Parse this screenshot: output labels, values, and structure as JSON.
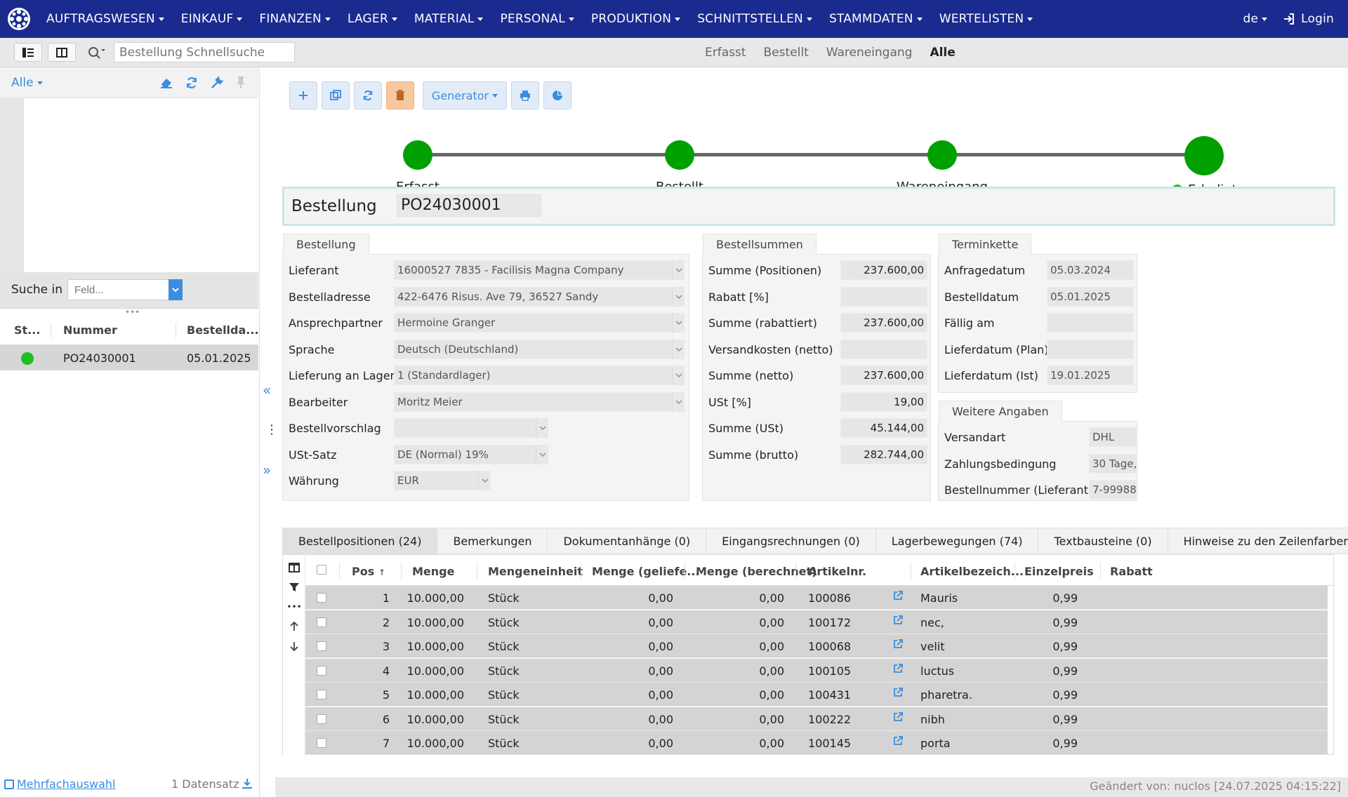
{
  "nav": {
    "menus": [
      "AUFTRAGSWESEN",
      "EINKAUF",
      "FINANZEN",
      "LAGER",
      "MATERIAL",
      "PERSONAL",
      "PRODUKTION",
      "SCHNITTSTELLEN",
      "STAMMDATEN",
      "WERTELISTEN"
    ],
    "language": "de",
    "login": "Login"
  },
  "subbar": {
    "search_placeholder": "Bestellung Schnellsuche",
    "filters": [
      "Erfasst",
      "Bestellt",
      "Wareneingang",
      "Alle"
    ],
    "active_filter": "Alle"
  },
  "left": {
    "filter": "Alle",
    "search_label": "Suche in",
    "search_placeholder": "Feld...",
    "columns": [
      "St...",
      "Nummer",
      "Bestellda..."
    ],
    "row": {
      "number": "PO24030001",
      "date": "05.01.2025",
      "status_color": "#1fbf1f"
    },
    "multi_select": "Mehrfachauswahl",
    "record_count": "1 Datensatz"
  },
  "toolbar": {
    "generator": "Generator"
  },
  "progress": {
    "steps": [
      "Erfasst",
      "Bestellt",
      "Wareneingang",
      "Erledigt"
    ],
    "current": "Erledigt",
    "color": "#00a000"
  },
  "order": {
    "label": "Bestellung",
    "number": "PO24030001"
  },
  "bestellung": {
    "title": "Bestellung",
    "fields": [
      {
        "label": "Lieferant",
        "value": "16000527 7835 - Facilisis Magna Company"
      },
      {
        "label": "Bestelladresse",
        "value": "422-6476 Risus. Ave 79, 36527 Sandy"
      },
      {
        "label": "Ansprechpartner",
        "value": "Hermoine Granger"
      },
      {
        "label": "Sprache",
        "value": "Deutsch (Deutschland)"
      },
      {
        "label": "Lieferung an Lager",
        "value": "1 (Standardlager)"
      },
      {
        "label": "Bearbeiter",
        "value": "Moritz Meier"
      },
      {
        "label": "Bestellvorschlag",
        "value": ""
      },
      {
        "label": "USt-Satz",
        "value": "DE (Normal) 19%"
      },
      {
        "label": "Währung",
        "value": "EUR"
      }
    ]
  },
  "summen": {
    "title": "Bestellsummen",
    "fields": [
      {
        "label": "Summe (Positionen)",
        "value": "237.600,00"
      },
      {
        "label": "Rabatt [%]",
        "value": ""
      },
      {
        "label": "Summe (rabattiert)",
        "value": "237.600,00"
      },
      {
        "label": "Versandkosten (netto)",
        "value": ""
      },
      {
        "label": "Summe (netto)",
        "value": "237.600,00"
      },
      {
        "label": "USt [%]",
        "value": "19,00"
      },
      {
        "label": "Summe (USt)",
        "value": "45.144,00"
      },
      {
        "label": "Summe (brutto)",
        "value": "282.744,00"
      }
    ]
  },
  "termin": {
    "title": "Terminkette",
    "fields": [
      {
        "label": "Anfragedatum",
        "value": "05.03.2024"
      },
      {
        "label": "Bestelldatum",
        "value": "05.01.2025"
      },
      {
        "label": "Fällig am",
        "value": ""
      },
      {
        "label": "Lieferdatum (Plan)",
        "value": ""
      },
      {
        "label": "Lieferdatum (Ist)",
        "value": "19.01.2025"
      }
    ]
  },
  "weitere": {
    "title": "Weitere Angaben",
    "fields": [
      {
        "label": "Versandart",
        "value": "DHL"
      },
      {
        "label": "Zahlungsbedingung",
        "value": "30 Tage,"
      },
      {
        "label": "Bestellnummer (Lieferant)",
        "value": "7-99988"
      }
    ]
  },
  "tabs": [
    "Bestellpositionen (24)",
    "Bemerkungen",
    "Dokumentanhänge (0)",
    "Eingangsrechnungen (0)",
    "Lagerbewegungen (74)",
    "Textbausteine (0)",
    "Hinweise zu den Zeilenfarben"
  ],
  "grid": {
    "columns": [
      "Pos",
      "Menge",
      "Mengeneinheit",
      "Menge (geliefe...",
      "Menge (berechnet)",
      "Artikelnr.",
      "Artikelbezeich...",
      "Einzelpreis",
      "Rabatt"
    ],
    "rows": [
      {
        "pos": "1",
        "menge": "10.000,00",
        "einheit": "Stück",
        "geliefert": "0,00",
        "berechnet": "0,00",
        "artikelnr": "100086",
        "bez": "Mauris",
        "preis": "0,99"
      },
      {
        "pos": "2",
        "menge": "10.000,00",
        "einheit": "Stück",
        "geliefert": "0,00",
        "berechnet": "0,00",
        "artikelnr": "100172",
        "bez": "nec,",
        "preis": "0,99"
      },
      {
        "pos": "3",
        "menge": "10.000,00",
        "einheit": "Stück",
        "geliefert": "0,00",
        "berechnet": "0,00",
        "artikelnr": "100068",
        "bez": "velit",
        "preis": "0,99"
      },
      {
        "pos": "4",
        "menge": "10.000,00",
        "einheit": "Stück",
        "geliefert": "0,00",
        "berechnet": "0,00",
        "artikelnr": "100105",
        "bez": "luctus",
        "preis": "0,99"
      },
      {
        "pos": "5",
        "menge": "10.000,00",
        "einheit": "Stück",
        "geliefert": "0,00",
        "berechnet": "0,00",
        "artikelnr": "100431",
        "bez": "pharetra.",
        "preis": "0,99"
      },
      {
        "pos": "6",
        "menge": "10.000,00",
        "einheit": "Stück",
        "geliefert": "0,00",
        "berechnet": "0,00",
        "artikelnr": "100222",
        "bez": "nibh",
        "preis": "0,99"
      },
      {
        "pos": "7",
        "menge": "10.000,00",
        "einheit": "Stück",
        "geliefert": "0,00",
        "berechnet": "0,00",
        "artikelnr": "100145",
        "bez": "porta",
        "preis": "0,99"
      }
    ]
  },
  "footer": {
    "changed": "Geändert von: nuclos [24.07.2025 04:15:22]"
  }
}
